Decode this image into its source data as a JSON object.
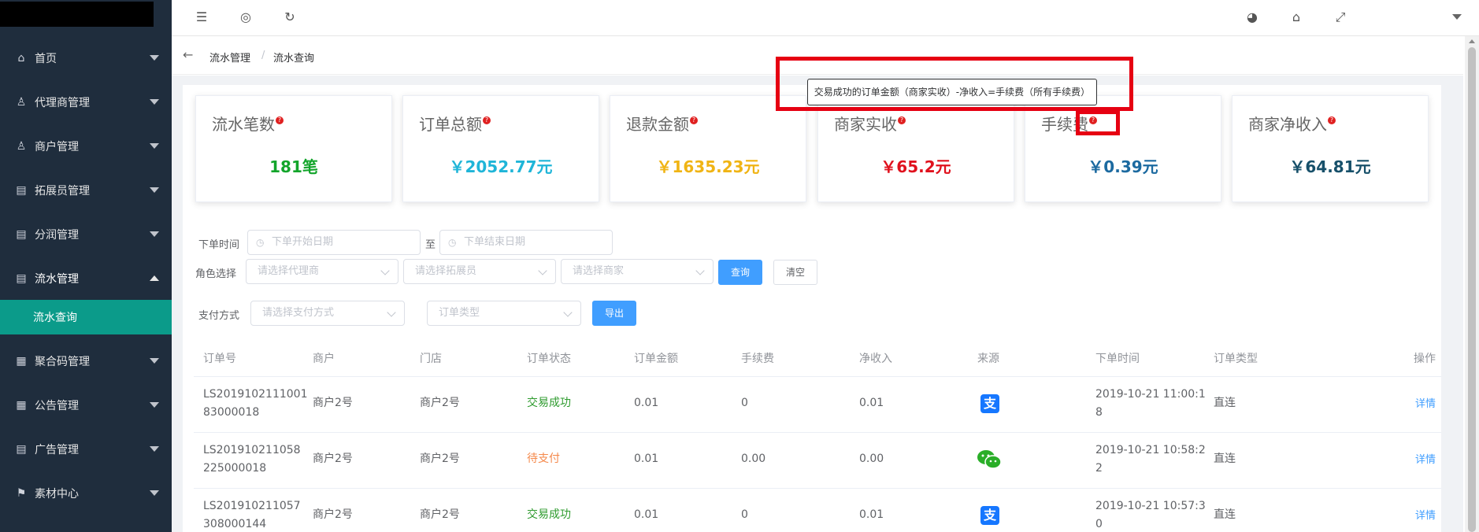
{
  "sidebar": {
    "items": [
      {
        "label": "首页",
        "icon": "home-icon"
      },
      {
        "label": "代理商管理",
        "icon": "user-icon"
      },
      {
        "label": "商户管理",
        "icon": "user-icon"
      },
      {
        "label": "拓展员管理",
        "icon": "clipboard-icon"
      },
      {
        "label": "分润管理",
        "icon": "clipboard-icon"
      },
      {
        "label": "流水管理",
        "icon": "clipboard-icon"
      },
      {
        "label": "聚合码管理",
        "icon": "grid-icon"
      },
      {
        "label": "公告管理",
        "icon": "grid-icon"
      },
      {
        "label": "广告管理",
        "icon": "clipboard-icon"
      },
      {
        "label": "素材中心",
        "icon": "flag-icon"
      }
    ],
    "active_sub": "流水查询"
  },
  "breadcrumb": {
    "parent": "流水管理",
    "separator": "/",
    "current": "流水查询"
  },
  "tooltip": "交易成功的订单金额（商家实收）-净收入=手续费（所有手续费）",
  "stats": [
    {
      "title": "流水笔数",
      "value": "181笔",
      "color": "#13a52b"
    },
    {
      "title": "订单总额",
      "value": "￥2052.77元",
      "color": "#1fb5d8"
    },
    {
      "title": "退款金额",
      "value": "￥1635.23元",
      "color": "#f0b414"
    },
    {
      "title": "商家实收",
      "value": "￥65.2元",
      "color": "#e0111d"
    },
    {
      "title": "手续费",
      "value": "￥0.39元",
      "color": "#1c6aa0"
    },
    {
      "title": "商家净收入",
      "value": "￥64.81元",
      "color": "#17506a"
    }
  ],
  "form": {
    "order_time_label": "下单时间",
    "start_placeholder": "下单开始日期",
    "to": "至",
    "end_placeholder": "下单结束日期",
    "role_label": "角色选择",
    "agent_placeholder": "请选择代理商",
    "expander_placeholder": "请选择拓展员",
    "merchant_placeholder": "请选择商家",
    "query": "查询",
    "clear": "清空",
    "pay_label": "支付方式",
    "pay_placeholder": "请选择支付方式",
    "order_type_placeholder": "订单类型",
    "export": "导出"
  },
  "table": {
    "headers": [
      "订单号",
      "商户",
      "门店",
      "订单状态",
      "订单金额",
      "手续费",
      "净收入",
      "来源",
      "下单时间",
      "订单类型",
      "操作"
    ],
    "rows": [
      {
        "order_no_1": "LS2019102111001",
        "order_no_2": "83000018",
        "merchant": "商户2号",
        "store": "商户2号",
        "status": "交易成功",
        "amount": "0.01",
        "fee": "0",
        "net": "0.01",
        "source": "alipay-icon",
        "time_1": "2019-10-21 11:00:1",
        "time_2": "8",
        "type": "直连",
        "action": "详情"
      },
      {
        "order_no_1": "LS201910211058",
        "order_no_2": "225000018",
        "merchant": "商户2号",
        "store": "商户2号",
        "status": "待支付",
        "amount": "0.01",
        "fee": "0.00",
        "net": "0.00",
        "source": "wechat-icon",
        "time_1": "2019-10-21 10:58:2",
        "time_2": "2",
        "type": "直连",
        "action": "详情"
      },
      {
        "order_no_1": "LS201910211057",
        "order_no_2": "308000144",
        "merchant": "商户2号",
        "store": "商户2号",
        "status": "交易成功",
        "amount": "0.01",
        "fee": "0",
        "net": "0.01",
        "source": "alipay-icon",
        "time_1": "2019-10-21 10:57:3",
        "time_2": "0",
        "type": "直连",
        "action": "详情"
      }
    ]
  }
}
